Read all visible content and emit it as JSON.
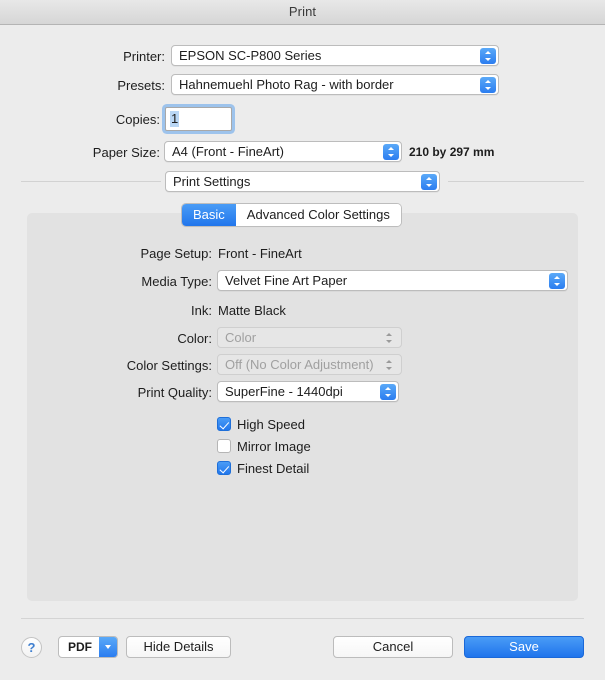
{
  "window": {
    "title": "Print"
  },
  "top_form": {
    "printer": {
      "label": "Printer:",
      "value": "EPSON SC-P800 Series"
    },
    "presets": {
      "label": "Presets:",
      "value": "Hahnemuehl Photo Rag - with border"
    },
    "copies": {
      "label": "Copies:",
      "value": "1"
    },
    "paper_size": {
      "label": "Paper Size:",
      "value": "A4 (Front - FineArt)",
      "dimensions": "210 by 297 mm"
    },
    "pane_selector": {
      "value": "Print Settings"
    }
  },
  "tabs": [
    {
      "label": "Basic",
      "selected": true
    },
    {
      "label": "Advanced Color Settings",
      "selected": false
    }
  ],
  "settings": {
    "page_setup": {
      "label": "Page Setup:",
      "value": "Front - FineArt"
    },
    "media_type": {
      "label": "Media Type:",
      "value": "Velvet Fine Art Paper"
    },
    "ink": {
      "label": "Ink:",
      "value": "Matte Black"
    },
    "color": {
      "label": "Color:",
      "value": "Color",
      "disabled": true
    },
    "color_settings": {
      "label": "Color Settings:",
      "value": "Off (No Color Adjustment)",
      "disabled": true
    },
    "print_quality": {
      "label": "Print Quality:",
      "value": "SuperFine - 1440dpi"
    },
    "checkboxes": [
      {
        "label": "High Speed",
        "checked": true
      },
      {
        "label": "Mirror Image",
        "checked": false
      },
      {
        "label": "Finest Detail",
        "checked": true
      }
    ]
  },
  "footer": {
    "help_glyph": "?",
    "pdf_label": "PDF",
    "hide_details_label": "Hide Details",
    "cancel_label": "Cancel",
    "save_label": "Save"
  },
  "colors": {
    "accent_blue": "#2176ec",
    "window_bg": "#ececec",
    "panel_bg": "#e2e2e2"
  }
}
